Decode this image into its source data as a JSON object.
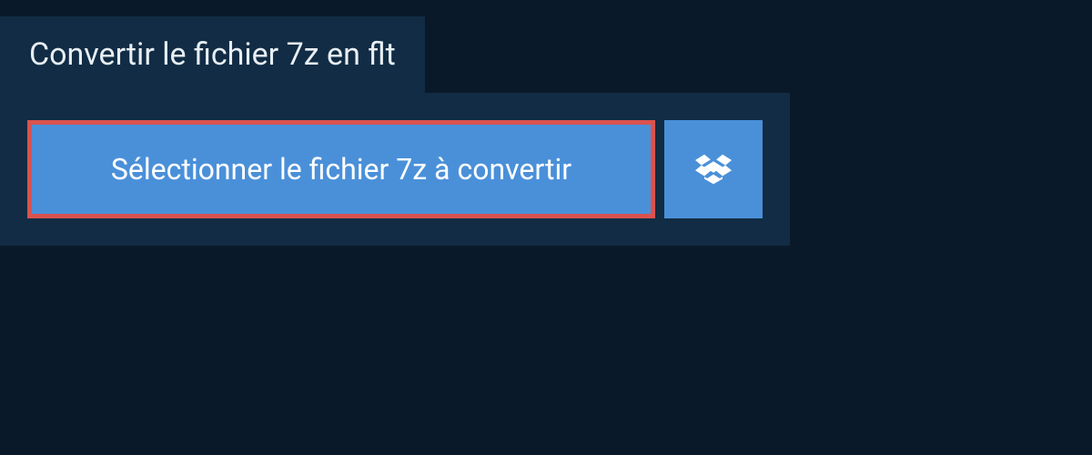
{
  "header": {
    "title": "Convertir le fichier 7z en flt"
  },
  "actions": {
    "select_file_label": "Sélectionner le fichier 7z à convertir"
  },
  "colors": {
    "background": "#0a1929",
    "panel": "#112c44",
    "button": "#4a90d9",
    "highlight_border": "#d9534f",
    "text_light": "#e8eef4",
    "text_white": "#ffffff"
  }
}
